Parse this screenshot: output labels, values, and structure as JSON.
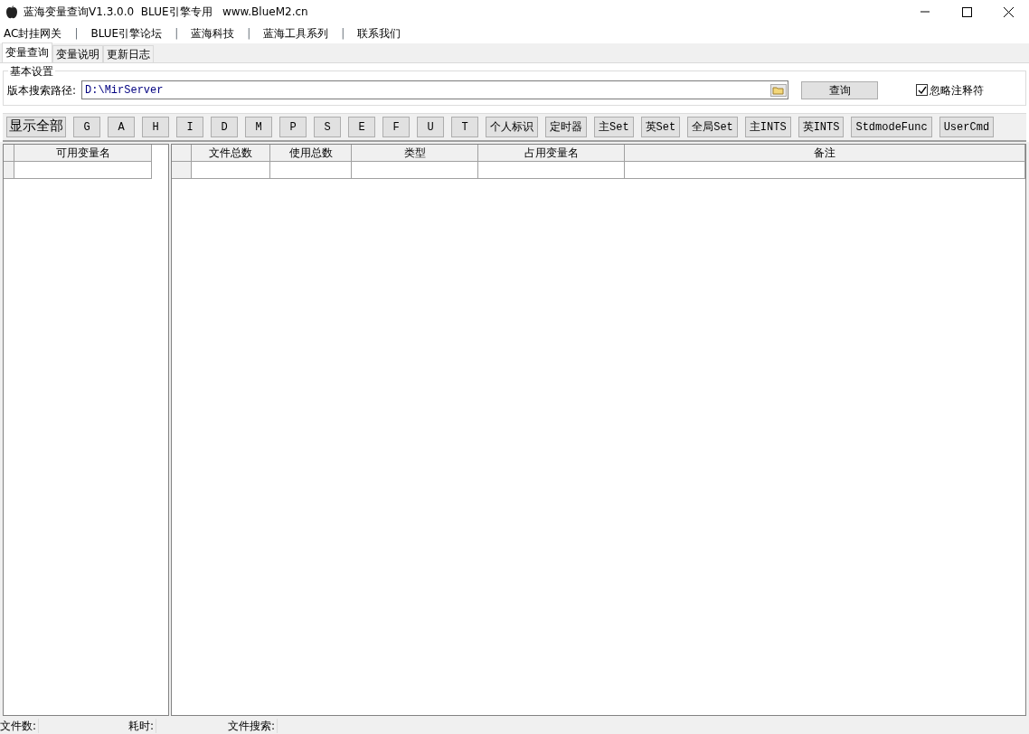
{
  "window": {
    "title": "蓝海变量查询V1.3.0.0  BLUE引擎专用   www.BlueM2.cn"
  },
  "menu": [
    {
      "kind": "item",
      "label": "AC封挂网关"
    },
    {
      "kind": "separator",
      "label": "|"
    },
    {
      "kind": "item",
      "label": "BLUE引擎论坛"
    },
    {
      "kind": "separator",
      "label": "|"
    },
    {
      "kind": "item",
      "label": "蓝海科技"
    },
    {
      "kind": "separator",
      "label": "|"
    },
    {
      "kind": "item",
      "label": "蓝海工具系列"
    },
    {
      "kind": "separator",
      "label": "|"
    },
    {
      "kind": "item",
      "label": "联系我们"
    }
  ],
  "tabs": [
    {
      "label": "变量查询",
      "selected": true
    },
    {
      "label": "变量说明",
      "selected": false
    },
    {
      "label": "更新日志",
      "selected": false
    }
  ],
  "settings": {
    "title": "基本设置",
    "path_label": "版本搜索路径:",
    "path_value": "D:\\MirServer",
    "query_button": "查询",
    "ignore_comments": {
      "label": "忽略注释符",
      "checked": true
    }
  },
  "filter_buttons": [
    "显示全部",
    "G",
    "A",
    "H",
    "I",
    "D",
    "M",
    "P",
    "S",
    "E",
    "F",
    "U",
    "T",
    "个人标识",
    "定时器",
    "主Set",
    "英Set",
    "全局Set",
    "主INTS",
    "英INTS",
    "StdmodeFunc",
    "UserCmd"
  ],
  "left_grid": {
    "columns": [
      "可用变量名"
    ]
  },
  "right_grid": {
    "columns": [
      "文件总数",
      "使用总数",
      "类型",
      "占用变量名",
      "备注"
    ]
  },
  "status_bar": [
    {
      "label": "文件数:"
    },
    {
      "label": "耗时:"
    },
    {
      "label": "文件搜索:"
    }
  ]
}
